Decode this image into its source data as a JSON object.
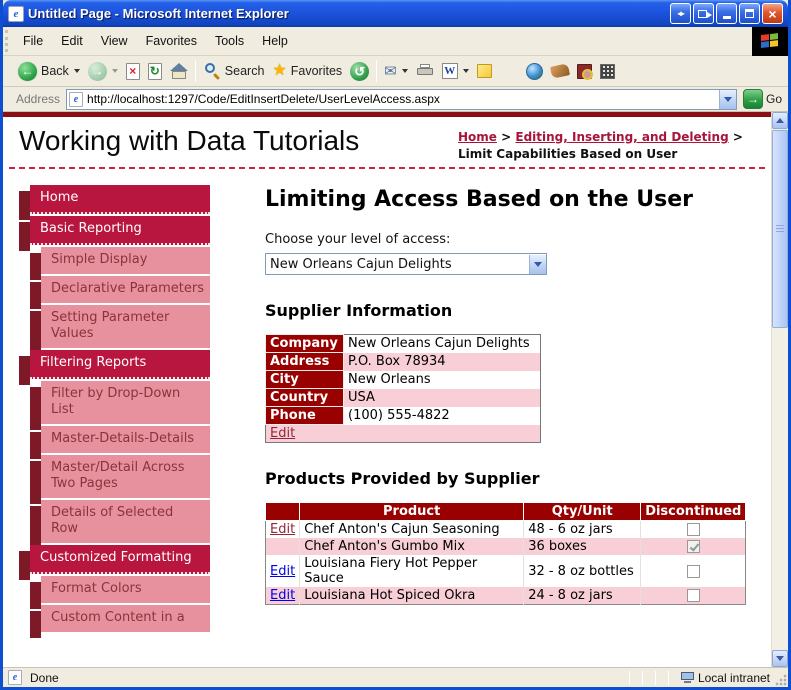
{
  "window": {
    "title": "Untitled Page - Microsoft Internet Explorer"
  },
  "menu": {
    "items": [
      "File",
      "Edit",
      "View",
      "Favorites",
      "Tools",
      "Help"
    ]
  },
  "toolbar": {
    "back": "Back",
    "search": "Search",
    "favorites": "Favorites"
  },
  "address": {
    "label": "Address",
    "url": "http://localhost:1297/Code/EditInsertDelete/UserLevelAccess.aspx",
    "go": "Go"
  },
  "header": {
    "site_title": "Working with Data Tutorials",
    "breadcrumb": {
      "home": "Home",
      "sep": ">",
      "section": "Editing, Inserting, and Deleting",
      "current": "Limit Capabilities Based on User"
    }
  },
  "sidebar": {
    "items": [
      {
        "label": "Home",
        "level": 1
      },
      {
        "label": "Basic Reporting",
        "level": 1
      },
      {
        "label": "Simple Display",
        "level": 2
      },
      {
        "label": "Declarative Parameters",
        "level": 2
      },
      {
        "label": "Setting Parameter Values",
        "level": 2
      },
      {
        "label": "Filtering Reports",
        "level": 1
      },
      {
        "label": "Filter by Drop-Down List",
        "level": 2
      },
      {
        "label": "Master-Details-Details",
        "level": 2
      },
      {
        "label": "Master/Detail Across Two Pages",
        "level": 2
      },
      {
        "label": "Details of Selected Row",
        "level": 2
      },
      {
        "label": "Customized Formatting",
        "level": 1
      },
      {
        "label": "Format Colors",
        "level": 2
      },
      {
        "label": "Custom Content in a",
        "level": 2
      }
    ]
  },
  "main": {
    "title": "Limiting Access Based on the User",
    "access_label": "Choose your level of access:",
    "access_selected": "New Orleans Cajun Delights",
    "supplier": {
      "heading": "Supplier Information",
      "fields": [
        {
          "label": "Company",
          "value": "New Orleans Cajun Delights"
        },
        {
          "label": "Address",
          "value": "P.O. Box 78934"
        },
        {
          "label": "City",
          "value": "New Orleans"
        },
        {
          "label": "Country",
          "value": "USA"
        },
        {
          "label": "Phone",
          "value": "(100) 555-4822"
        }
      ],
      "edit": "Edit"
    },
    "products": {
      "heading": "Products Provided by Supplier",
      "columns": {
        "product": "Product",
        "qty": "Qty/Unit",
        "discontinued": "Discontinued"
      },
      "rows": [
        {
          "edit": "Edit",
          "product": "Chef Anton's Cajun Seasoning",
          "qty": "48 - 6 oz jars",
          "discontinued": false
        },
        {
          "edit": "",
          "product": "Chef Anton's Gumbo Mix",
          "qty": "36 boxes",
          "discontinued": true
        },
        {
          "edit": "Edit",
          "product": "Louisiana Fiery Hot Pepper Sauce",
          "qty": "32 - 8 oz bottles",
          "discontinued": false
        },
        {
          "edit": "Edit",
          "product": "Louisiana Hot Spiced Okra",
          "qty": "24 - 8 oz jars",
          "discontinued": false
        }
      ]
    }
  },
  "status": {
    "text": "Done",
    "zone": "Local intranet"
  },
  "colors": {
    "accent_crimson": "#B8163F",
    "menu_shadow": "#7E1A28",
    "menu_sub_bg": "#E8919E",
    "menu_sub_text": "#8B333B",
    "table_header": "#990000",
    "row_pink": "#F8CFD6",
    "link_blue": "#0000EE",
    "link_visited": "#96243A",
    "xp_title_blue": "#1D53DE"
  }
}
